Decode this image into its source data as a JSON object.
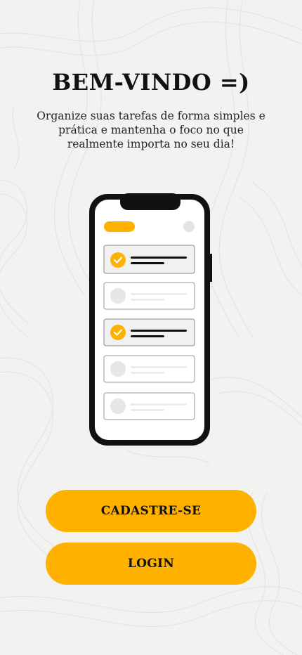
{
  "welcome": {
    "title": "BEM-VINDO =)",
    "subtitle": "Organize suas tarefas de forma simples e prática e mantenha o foco no que realmente importa no seu dia!"
  },
  "illustration": {
    "icon": "phone-task-list-illustration",
    "tasks": [
      {
        "checked": true
      },
      {
        "checked": false
      },
      {
        "checked": true
      },
      {
        "checked": false
      },
      {
        "checked": false
      }
    ]
  },
  "actions": {
    "signup_label": "CADASTRE-SE",
    "login_label": "LOGIN"
  },
  "colors": {
    "accent": "#ffb100",
    "background": "#f2f2f1",
    "text": "#111111"
  }
}
